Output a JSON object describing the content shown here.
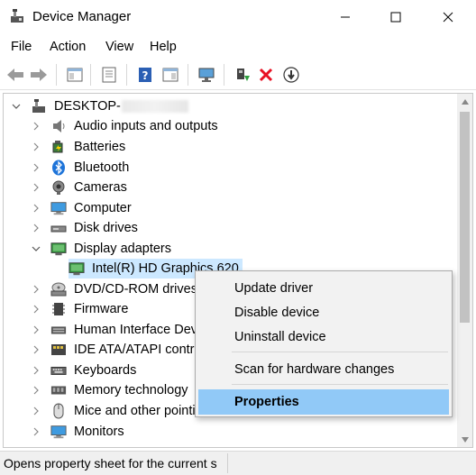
{
  "window": {
    "title": "Device Manager"
  },
  "menu": [
    "File",
    "Action",
    "View",
    "Help"
  ],
  "toolbar": {
    "buttons": [
      "back-icon",
      "forward-icon",
      "show-hide-console-tree-icon",
      "properties-icon",
      "help-icon",
      "action-pane-icon",
      "scan-hardware-icon",
      "update-driver-icon",
      "uninstall-device-icon",
      "disable-device-icon"
    ]
  },
  "tree": {
    "root": {
      "label": "DESKTOP-",
      "hidden_suffix": true
    },
    "items": [
      {
        "label": "Audio inputs and outputs",
        "icon": "speaker-icon",
        "expanded": false
      },
      {
        "label": "Batteries",
        "icon": "battery-icon",
        "expanded": false
      },
      {
        "label": "Bluetooth",
        "icon": "bluetooth-icon",
        "expanded": false
      },
      {
        "label": "Cameras",
        "icon": "camera-icon",
        "expanded": false
      },
      {
        "label": "Computer",
        "icon": "computer-icon",
        "expanded": false
      },
      {
        "label": "Disk drives",
        "icon": "disk-drive-icon",
        "expanded": false
      },
      {
        "label": "Display adapters",
        "icon": "display-adapter-icon",
        "expanded": true
      },
      {
        "label": "Intel(R) HD Graphics 620",
        "icon": "display-adapter-icon",
        "child": true,
        "selected": true
      },
      {
        "label": "DVD/CD-ROM drives",
        "icon": "dvd-drive-icon",
        "expanded": false
      },
      {
        "label": "Firmware",
        "icon": "firmware-icon",
        "expanded": false
      },
      {
        "label": "Human Interface Dev",
        "icon": "hid-icon",
        "expanded": false
      },
      {
        "label": "IDE ATA/ATAPI control",
        "icon": "ide-controller-icon",
        "expanded": false
      },
      {
        "label": "Keyboards",
        "icon": "keyboard-icon",
        "expanded": false
      },
      {
        "label": "Memory technology",
        "icon": "memory-icon",
        "expanded": false
      },
      {
        "label": "Mice and other pointing",
        "icon": "mouse-icon",
        "expanded": false
      },
      {
        "label": "Monitors",
        "icon": "monitor-icon",
        "expanded": false
      }
    ]
  },
  "context_menu": {
    "items": [
      "Update driver",
      "Disable device",
      "Uninstall device",
      "Scan for hardware changes",
      "Properties"
    ],
    "highlighted": "Properties"
  },
  "status": {
    "text": "Opens property sheet for the current s"
  },
  "colors": {
    "selection": "#cce8ff",
    "menu_highlight": "#91c9f7",
    "delete_red": "#e81123",
    "status_bg": "#f0f0f0"
  }
}
